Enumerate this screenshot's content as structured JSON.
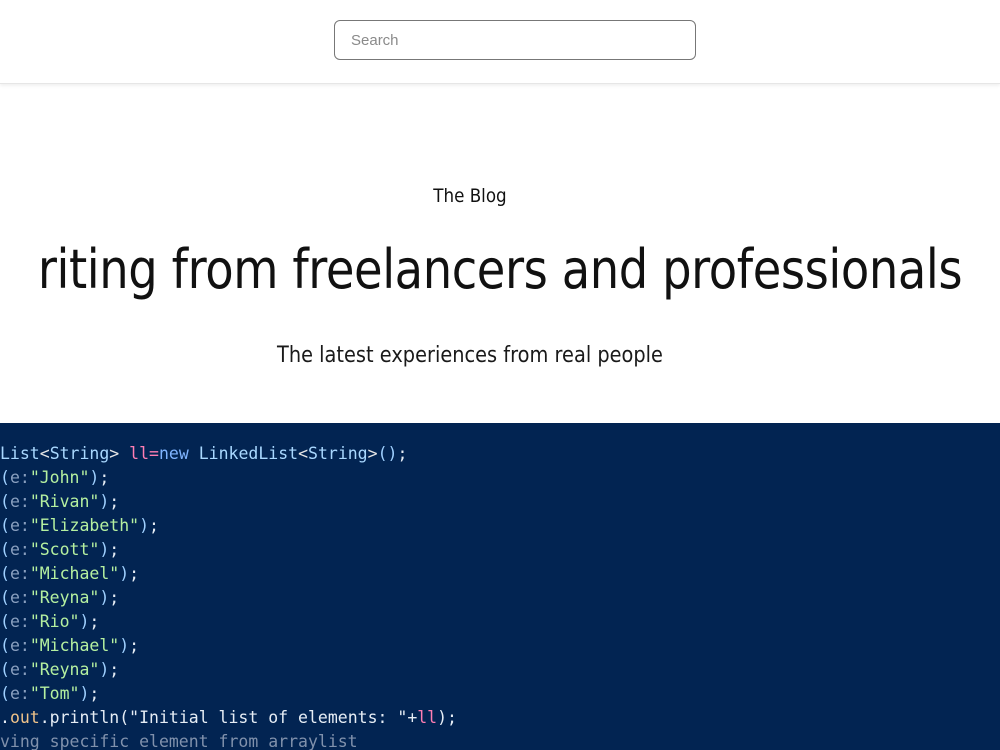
{
  "search": {
    "placeholder": "Search"
  },
  "hero": {
    "eyebrow": "The Blog",
    "title": "riting from freelancers and professionals",
    "subtitle": "The latest experiences from real people"
  },
  "code": {
    "line1": {
      "type_list": "List",
      "lt": "<",
      "type_string": "String",
      "gt": "> ",
      "var": "ll",
      "eq": "=",
      "kw_new": "new ",
      "type_linked": "LinkedList",
      "lt2": "<",
      "type_string2": "String",
      "gt2": ">",
      "parens": "()",
      "semi": ";"
    },
    "add_param": "e:",
    "add_calls": [
      "\"John\"",
      "\"Rivan\"",
      "\"Elizabeth\"",
      "\"Scott\"",
      "\"Michael\"",
      "\"Reyna\"",
      "\"Rio\"",
      "\"Michael\"",
      "\"Reyna\"",
      "\"Tom\""
    ],
    "println": {
      "prefix": ".",
      "field": "out",
      "method": ".println(",
      "string": "\"Initial list of elements: \"",
      "plus": "+",
      "var": "ll",
      "end": ");"
    },
    "comment": "ving specific element from arraylist"
  },
  "colors": {
    "code_background": "#022452",
    "search_border": "#777777"
  }
}
